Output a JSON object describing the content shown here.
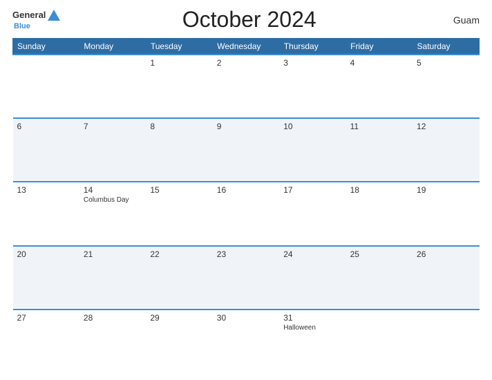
{
  "header": {
    "logo_line1": "General",
    "logo_line2": "Blue",
    "title": "October 2024",
    "region": "Guam"
  },
  "calendar": {
    "weekdays": [
      "Sunday",
      "Monday",
      "Tuesday",
      "Wednesday",
      "Thursday",
      "Friday",
      "Saturday"
    ],
    "weeks": [
      [
        {
          "day": "",
          "event": ""
        },
        {
          "day": "",
          "event": ""
        },
        {
          "day": "1",
          "event": ""
        },
        {
          "day": "2",
          "event": ""
        },
        {
          "day": "3",
          "event": ""
        },
        {
          "day": "4",
          "event": ""
        },
        {
          "day": "5",
          "event": ""
        }
      ],
      [
        {
          "day": "6",
          "event": ""
        },
        {
          "day": "7",
          "event": ""
        },
        {
          "day": "8",
          "event": ""
        },
        {
          "day": "9",
          "event": ""
        },
        {
          "day": "10",
          "event": ""
        },
        {
          "day": "11",
          "event": ""
        },
        {
          "day": "12",
          "event": ""
        }
      ],
      [
        {
          "day": "13",
          "event": ""
        },
        {
          "day": "14",
          "event": "Columbus Day"
        },
        {
          "day": "15",
          "event": ""
        },
        {
          "day": "16",
          "event": ""
        },
        {
          "day": "17",
          "event": ""
        },
        {
          "day": "18",
          "event": ""
        },
        {
          "day": "19",
          "event": ""
        }
      ],
      [
        {
          "day": "20",
          "event": ""
        },
        {
          "day": "21",
          "event": ""
        },
        {
          "day": "22",
          "event": ""
        },
        {
          "day": "23",
          "event": ""
        },
        {
          "day": "24",
          "event": ""
        },
        {
          "day": "25",
          "event": ""
        },
        {
          "day": "26",
          "event": ""
        }
      ],
      [
        {
          "day": "27",
          "event": ""
        },
        {
          "day": "28",
          "event": ""
        },
        {
          "day": "29",
          "event": ""
        },
        {
          "day": "30",
          "event": ""
        },
        {
          "day": "31",
          "event": "Halloween"
        },
        {
          "day": "",
          "event": ""
        },
        {
          "day": "",
          "event": ""
        }
      ]
    ]
  }
}
